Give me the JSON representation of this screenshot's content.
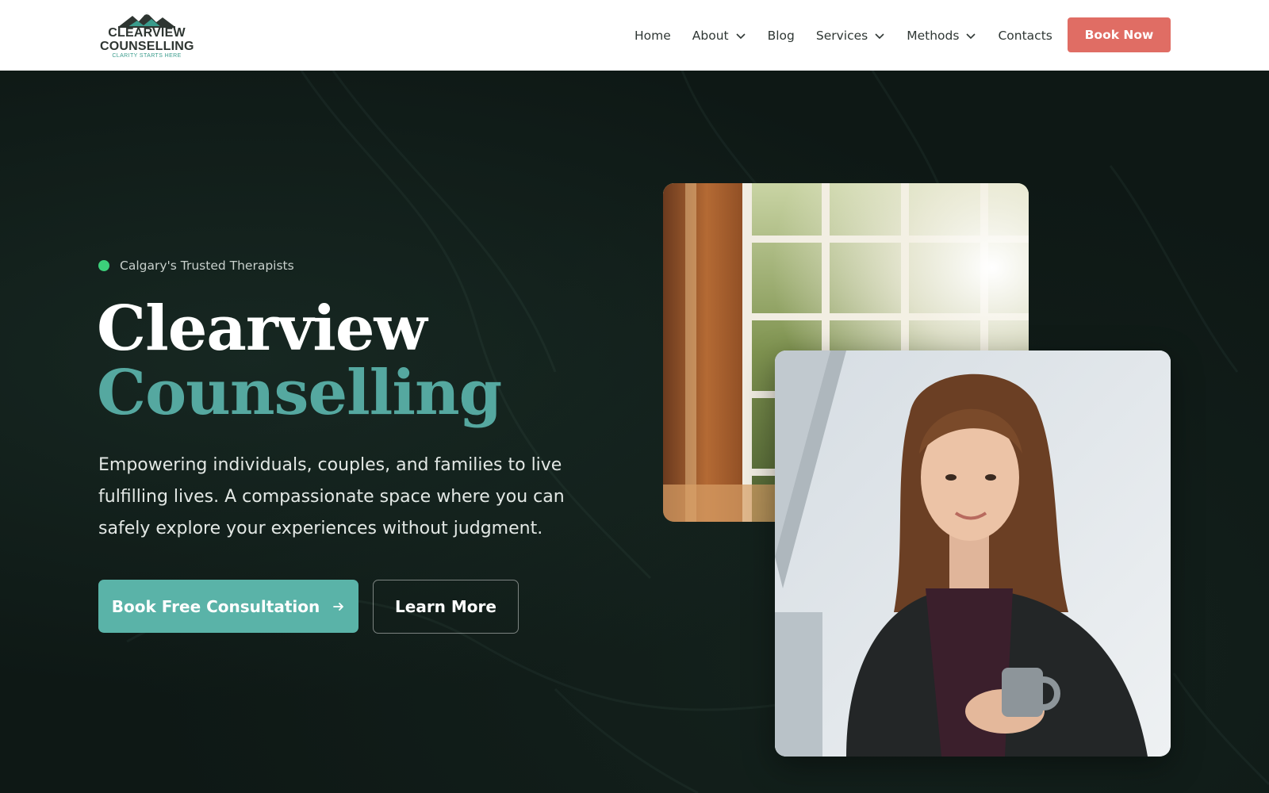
{
  "header": {
    "logo": {
      "line1": "CLEARVIEW",
      "line2": "COUNSELLING",
      "tagline": "CLARITY STARTS HERE",
      "icon": "mountain-logo-icon"
    },
    "nav": [
      {
        "label": "Home",
        "dropdown": false
      },
      {
        "label": "About",
        "dropdown": true
      },
      {
        "label": "Blog",
        "dropdown": false
      },
      {
        "label": "Services",
        "dropdown": true
      },
      {
        "label": "Methods",
        "dropdown": true
      },
      {
        "label": "Contacts",
        "dropdown": false
      }
    ],
    "cta_label": "Book Now"
  },
  "hero": {
    "badge": "Calgary's Trusted Therapists",
    "title_line1": "Clearview",
    "title_line2": "Counselling",
    "description": "Empowering individuals, couples, and families to live fulfilling lives. A compassionate space where you can safely explore your experiences without judgment.",
    "primary_button": "Book Free Consultation",
    "secondary_button": "Learn More"
  },
  "colors": {
    "accent_coral": "#e06d64",
    "accent_teal": "#5ab3a8",
    "title_teal": "#55a8a0",
    "hero_bg": "#0e1815",
    "status_green": "#3ccf7a"
  },
  "icons": {
    "chevron": "chevron-down-icon",
    "arrow": "arrow-right-icon",
    "badge_dot": "status-dot-icon"
  }
}
